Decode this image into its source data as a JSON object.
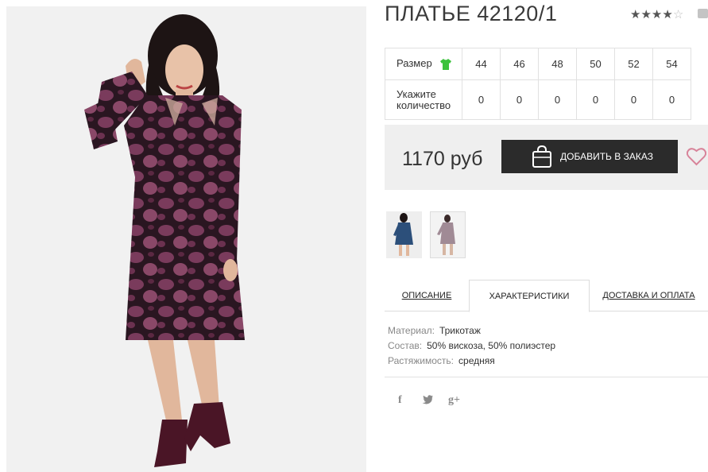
{
  "product": {
    "title": "ПЛАТЬЕ 42120/1",
    "rating_stars": 4,
    "rating_max": 5,
    "price": "1170 руб"
  },
  "sizes_table": {
    "size_label": "Размер",
    "qty_label_line1": "Укажите",
    "qty_label_line2": "количество",
    "sizes": [
      "44",
      "46",
      "48",
      "50",
      "52",
      "54"
    ],
    "quantities": [
      "0",
      "0",
      "0",
      "0",
      "0",
      "0"
    ]
  },
  "buy": {
    "add_label": "ДОБАВИТЬ В ЗАКАЗ"
  },
  "tabs": {
    "description": "ОПИСАНИЕ",
    "characteristics": "ХАРАКТЕРИСТИКИ",
    "delivery": "ДОСТАВКА И ОПЛАТА",
    "active": "characteristics"
  },
  "specs": [
    {
      "key": "Материал:",
      "value": "Трикотаж"
    },
    {
      "key": "Состав:",
      "value": "50% вискоза, 50% полиэстер"
    },
    {
      "key": "Растяжимость:",
      "value": "средняя"
    }
  ],
  "social": {
    "facebook": "f",
    "twitter": "🐦",
    "gplus": "g+"
  },
  "colors": {
    "button_bg": "#2b2b2b",
    "buy_box_bg": "#efefef",
    "dress_main": "#7a3b5c",
    "dress_dark": "#2a1621",
    "thumb_dress_blue": "#2c4f7a",
    "heart": "#d8849a",
    "tshirt_green": "#3cc23c"
  },
  "icons": [
    "star-icon",
    "comment-icon",
    "tshirt-icon",
    "shopping-bag-icon",
    "heart-icon",
    "facebook-icon",
    "twitter-icon",
    "google-plus-icon"
  ]
}
